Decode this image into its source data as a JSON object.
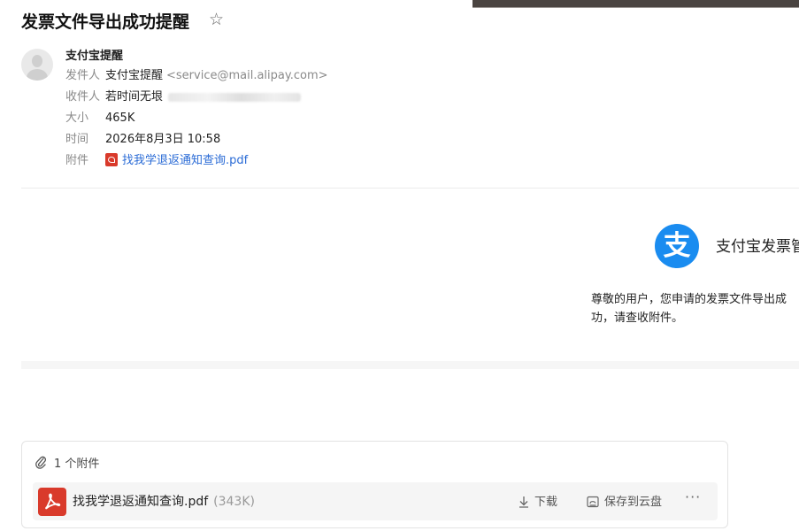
{
  "email": {
    "subject": "发票文件导出成功提醒",
    "sender_name": "支付宝提醒",
    "meta": {
      "from_label": "发件人",
      "from_name": "支付宝提醒",
      "from_email": "<service@mail.alipay.com>",
      "to_label": "收件人",
      "to_name": "若时间无垠",
      "size_label": "大小",
      "size_value": "465K",
      "time_label": "时间",
      "time_value": "2026年8月3日 10:58",
      "attach_label": "附件",
      "attach_name": "找我学退返通知查询.pdf"
    }
  },
  "body": {
    "logo_glyph": "支",
    "brand_title": "支付宝发票管",
    "text": "尊敬的用户，您申请的发票文件导出成功，请查收附件。"
  },
  "attachments": {
    "count_text": "1 个附件",
    "file": {
      "name": "找我学退返通知查询.pdf",
      "size": "(343K)",
      "download_label": "下载",
      "save_cloud_label": "保存到云盘",
      "more_glyph": "···"
    }
  },
  "colors": {
    "link": "#2a6bd6",
    "pdf_red": "#d93a2b",
    "alipay_blue": "#1a8cf0"
  },
  "icons": [
    "star-icon",
    "avatar",
    "pdf-icon",
    "paperclip-icon",
    "download-icon",
    "cloud-save-icon",
    "more-icon"
  ]
}
